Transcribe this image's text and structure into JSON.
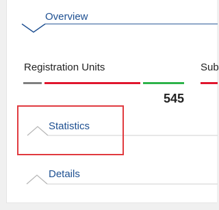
{
  "sections": {
    "overview": {
      "title": "Overview"
    },
    "statistics": {
      "title": "Statistics"
    },
    "details": {
      "title": "Details"
    }
  },
  "overview": {
    "cards": [
      {
        "label": "Registration Units",
        "value": "545"
      },
      {
        "label": "Sub"
      }
    ],
    "status_colors": {
      "neutral": "#7f7f7f",
      "red": "#e0152d",
      "green": "#2db34a"
    }
  },
  "colors": {
    "accent": "#1d4f91",
    "highlight": "#e0393e"
  },
  "icons": {
    "collapse": "chevron-down-icon",
    "expand": "chevron-up-icon"
  }
}
